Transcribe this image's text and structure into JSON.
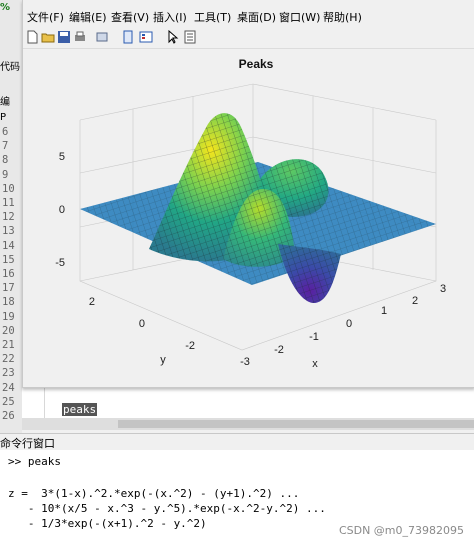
{
  "figure": {
    "menus": [
      "文件(F)",
      "编辑(E)",
      "查看(V)",
      "插入(I)",
      "工具(T)",
      "桌面(D)",
      "窗口(W)",
      "帮助(H)"
    ],
    "toolbar_icons": [
      "new-figure-icon",
      "open-file-icon",
      "save-icon",
      "print-icon",
      "link-icon",
      "dock-icon",
      "insert-colorbar-icon",
      "pointer-icon",
      "property-editor-icon"
    ],
    "plot": {
      "title": "Peaks",
      "xlabel": "x",
      "ylabel": "y",
      "z_ticks": [
        "5",
        "0",
        "-5"
      ],
      "x_ticks": [
        "-3",
        "-2",
        "-1",
        "0",
        "1",
        "2",
        "3"
      ],
      "y_ticks": [
        "2",
        "0",
        "-2"
      ]
    }
  },
  "left_panel": {
    "labels": [
      "%",
      "代码",
      "编",
      "P"
    ],
    "line_numbers": [
      "6",
      "7",
      "8",
      "9",
      "10",
      "11",
      "12",
      "13",
      "14",
      "15",
      "16",
      "17",
      "18",
      "19",
      "20",
      "21",
      "22",
      "23",
      "24",
      "25",
      "26"
    ]
  },
  "editor": {
    "current_line_text": "peaks"
  },
  "command_window": {
    "title": "命令行窗口",
    "lines": [
      ">> peaks",
      "",
      "z =  3*(1-x).^2.*exp(-(x.^2) - (y+1).^2) ...",
      "   - 10*(x/5 - x.^3 - y.^5).*exp(-x.^2-y.^2) ...",
      "   - 1/3*exp(-(x+1).^2 - y.^2)"
    ]
  },
  "watermark": "CSDN @m0_73982095"
}
